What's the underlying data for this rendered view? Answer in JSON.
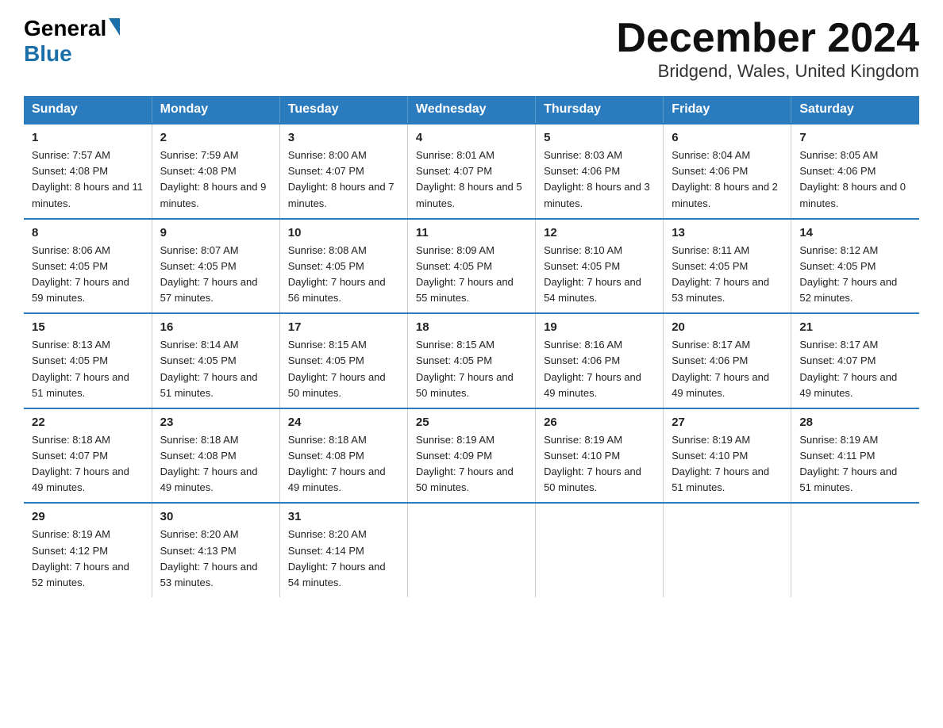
{
  "logo": {
    "general_text": "General",
    "blue_text": "Blue"
  },
  "title": "December 2024",
  "subtitle": "Bridgend, Wales, United Kingdom",
  "days_of_week": [
    "Sunday",
    "Monday",
    "Tuesday",
    "Wednesday",
    "Thursday",
    "Friday",
    "Saturday"
  ],
  "weeks": [
    [
      {
        "day": "1",
        "sunrise": "7:57 AM",
        "sunset": "4:08 PM",
        "daylight": "8 hours and 11 minutes."
      },
      {
        "day": "2",
        "sunrise": "7:59 AM",
        "sunset": "4:08 PM",
        "daylight": "8 hours and 9 minutes."
      },
      {
        "day": "3",
        "sunrise": "8:00 AM",
        "sunset": "4:07 PM",
        "daylight": "8 hours and 7 minutes."
      },
      {
        "day": "4",
        "sunrise": "8:01 AM",
        "sunset": "4:07 PM",
        "daylight": "8 hours and 5 minutes."
      },
      {
        "day": "5",
        "sunrise": "8:03 AM",
        "sunset": "4:06 PM",
        "daylight": "8 hours and 3 minutes."
      },
      {
        "day": "6",
        "sunrise": "8:04 AM",
        "sunset": "4:06 PM",
        "daylight": "8 hours and 2 minutes."
      },
      {
        "day": "7",
        "sunrise": "8:05 AM",
        "sunset": "4:06 PM",
        "daylight": "8 hours and 0 minutes."
      }
    ],
    [
      {
        "day": "8",
        "sunrise": "8:06 AM",
        "sunset": "4:05 PM",
        "daylight": "7 hours and 59 minutes."
      },
      {
        "day": "9",
        "sunrise": "8:07 AM",
        "sunset": "4:05 PM",
        "daylight": "7 hours and 57 minutes."
      },
      {
        "day": "10",
        "sunrise": "8:08 AM",
        "sunset": "4:05 PM",
        "daylight": "7 hours and 56 minutes."
      },
      {
        "day": "11",
        "sunrise": "8:09 AM",
        "sunset": "4:05 PM",
        "daylight": "7 hours and 55 minutes."
      },
      {
        "day": "12",
        "sunrise": "8:10 AM",
        "sunset": "4:05 PM",
        "daylight": "7 hours and 54 minutes."
      },
      {
        "day": "13",
        "sunrise": "8:11 AM",
        "sunset": "4:05 PM",
        "daylight": "7 hours and 53 minutes."
      },
      {
        "day": "14",
        "sunrise": "8:12 AM",
        "sunset": "4:05 PM",
        "daylight": "7 hours and 52 minutes."
      }
    ],
    [
      {
        "day": "15",
        "sunrise": "8:13 AM",
        "sunset": "4:05 PM",
        "daylight": "7 hours and 51 minutes."
      },
      {
        "day": "16",
        "sunrise": "8:14 AM",
        "sunset": "4:05 PM",
        "daylight": "7 hours and 51 minutes."
      },
      {
        "day": "17",
        "sunrise": "8:15 AM",
        "sunset": "4:05 PM",
        "daylight": "7 hours and 50 minutes."
      },
      {
        "day": "18",
        "sunrise": "8:15 AM",
        "sunset": "4:05 PM",
        "daylight": "7 hours and 50 minutes."
      },
      {
        "day": "19",
        "sunrise": "8:16 AM",
        "sunset": "4:06 PM",
        "daylight": "7 hours and 49 minutes."
      },
      {
        "day": "20",
        "sunrise": "8:17 AM",
        "sunset": "4:06 PM",
        "daylight": "7 hours and 49 minutes."
      },
      {
        "day": "21",
        "sunrise": "8:17 AM",
        "sunset": "4:07 PM",
        "daylight": "7 hours and 49 minutes."
      }
    ],
    [
      {
        "day": "22",
        "sunrise": "8:18 AM",
        "sunset": "4:07 PM",
        "daylight": "7 hours and 49 minutes."
      },
      {
        "day": "23",
        "sunrise": "8:18 AM",
        "sunset": "4:08 PM",
        "daylight": "7 hours and 49 minutes."
      },
      {
        "day": "24",
        "sunrise": "8:18 AM",
        "sunset": "4:08 PM",
        "daylight": "7 hours and 49 minutes."
      },
      {
        "day": "25",
        "sunrise": "8:19 AM",
        "sunset": "4:09 PM",
        "daylight": "7 hours and 50 minutes."
      },
      {
        "day": "26",
        "sunrise": "8:19 AM",
        "sunset": "4:10 PM",
        "daylight": "7 hours and 50 minutes."
      },
      {
        "day": "27",
        "sunrise": "8:19 AM",
        "sunset": "4:10 PM",
        "daylight": "7 hours and 51 minutes."
      },
      {
        "day": "28",
        "sunrise": "8:19 AM",
        "sunset": "4:11 PM",
        "daylight": "7 hours and 51 minutes."
      }
    ],
    [
      {
        "day": "29",
        "sunrise": "8:19 AM",
        "sunset": "4:12 PM",
        "daylight": "7 hours and 52 minutes."
      },
      {
        "day": "30",
        "sunrise": "8:20 AM",
        "sunset": "4:13 PM",
        "daylight": "7 hours and 53 minutes."
      },
      {
        "day": "31",
        "sunrise": "8:20 AM",
        "sunset": "4:14 PM",
        "daylight": "7 hours and 54 minutes."
      },
      null,
      null,
      null,
      null
    ]
  ],
  "labels": {
    "sunrise": "Sunrise:",
    "sunset": "Sunset:",
    "daylight": "Daylight:"
  }
}
